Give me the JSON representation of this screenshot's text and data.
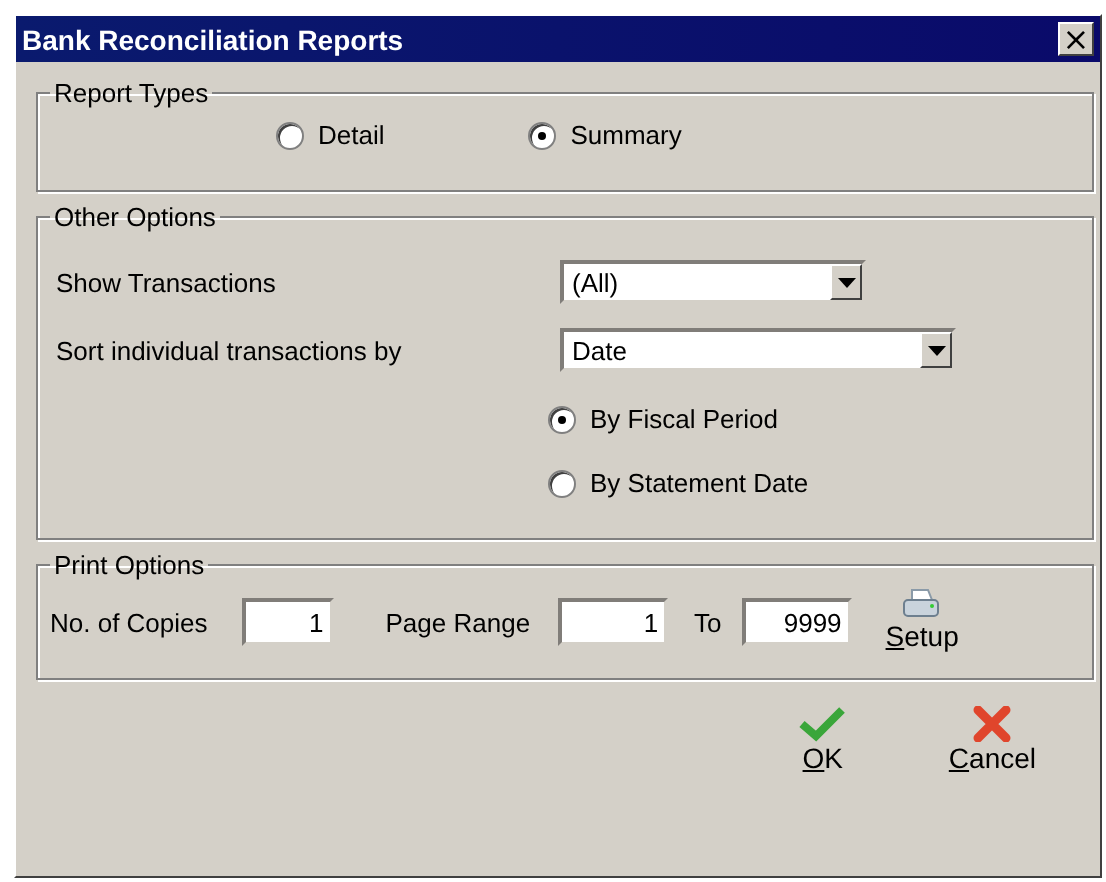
{
  "window": {
    "title": "Bank Reconciliation Reports",
    "close": "×"
  },
  "report_types": {
    "legend": "Report Types",
    "options": [
      {
        "label": "Detail",
        "selected": false
      },
      {
        "label": "Summary",
        "selected": true
      }
    ]
  },
  "other_options": {
    "legend": "Other Options",
    "fields": [
      {
        "label": "Show Transactions",
        "value": "(All)",
        "wide": false
      },
      {
        "label": "Sort individual transactions by",
        "value": "Date",
        "wide": true
      }
    ],
    "date_basis": [
      {
        "label": "By Fiscal Period",
        "selected": true
      },
      {
        "label": "By Statement Date",
        "selected": false
      }
    ]
  },
  "print_options": {
    "legend": "Print Options",
    "copies_label": "No. of Copies",
    "copies": "1",
    "range_label": "Page Range",
    "range_from": "1",
    "to_label": "To",
    "range_to": "9999",
    "setup": {
      "access_key": "S",
      "rest": "etup"
    }
  },
  "buttons": [
    {
      "kind": "ok",
      "access_key": "O",
      "rest": "K"
    },
    {
      "kind": "cancel",
      "access_key": "C",
      "rest": "ancel"
    }
  ]
}
